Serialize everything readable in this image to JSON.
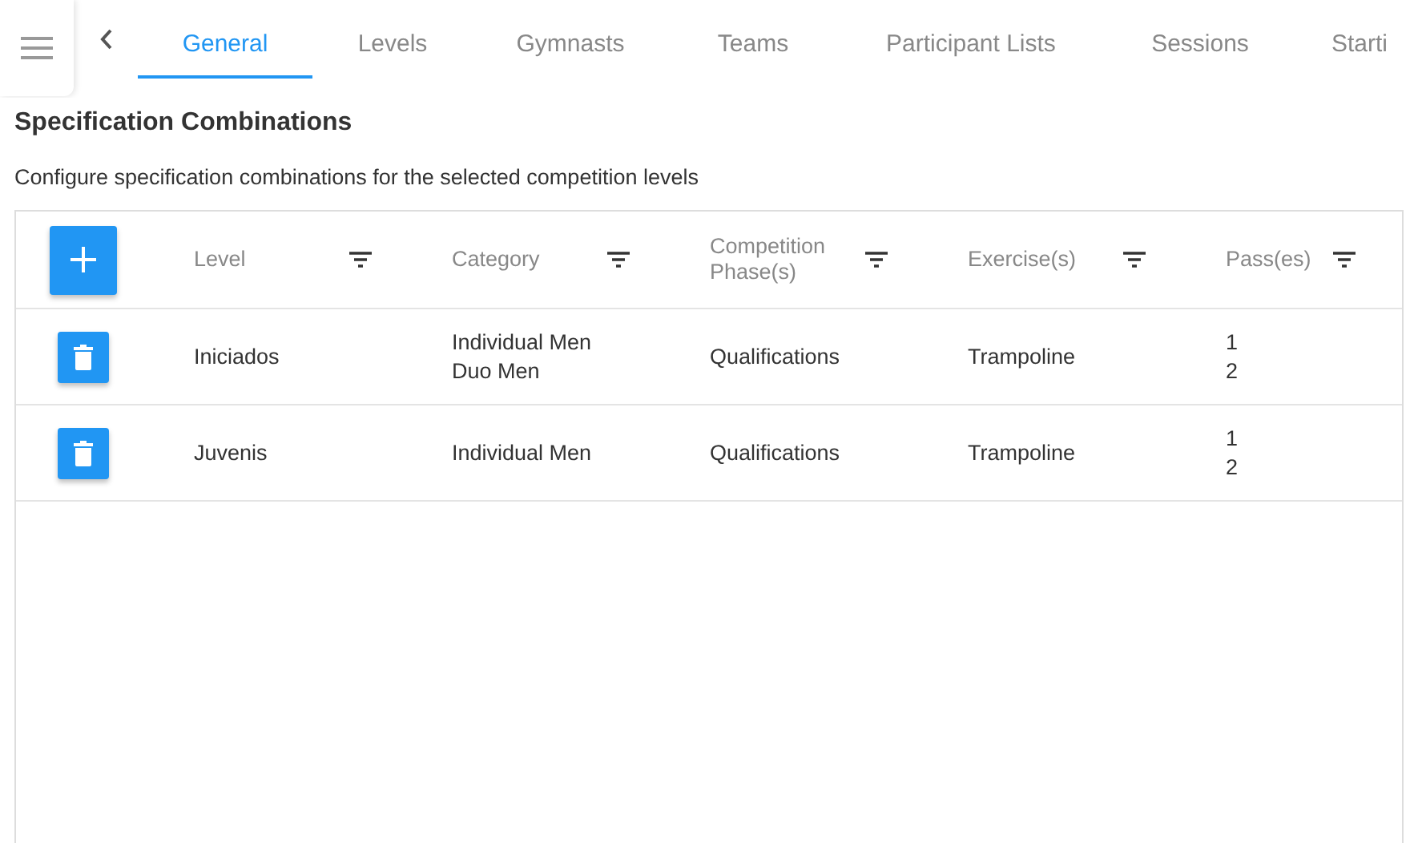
{
  "tabs": [
    {
      "label": "General",
      "selected": true
    },
    {
      "label": "Levels",
      "selected": false
    },
    {
      "label": "Gymnasts",
      "selected": false
    },
    {
      "label": "Teams",
      "selected": false
    },
    {
      "label": "Participant Lists",
      "selected": false
    },
    {
      "label": "Sessions",
      "selected": false
    },
    {
      "label": "Starti",
      "selected": false
    }
  ],
  "heading": "Specification Combinations",
  "description": "Configure specification combinations for the selected competition levels",
  "table": {
    "columns": [
      "Level",
      "Category",
      "Competition Phase(s)",
      "Exercise(s)",
      "Pass(es)"
    ],
    "rows": [
      {
        "level": "Iniciados",
        "categories": [
          "Individual Men",
          "Duo Men"
        ],
        "phases": [
          "Qualifications"
        ],
        "exercises": [
          "Trampoline"
        ],
        "passes": [
          "1",
          "2"
        ]
      },
      {
        "level": "Juvenis",
        "categories": [
          "Individual Men"
        ],
        "phases": [
          "Qualifications"
        ],
        "exercises": [
          "Trampoline"
        ],
        "passes": [
          "1",
          "2"
        ]
      }
    ]
  }
}
